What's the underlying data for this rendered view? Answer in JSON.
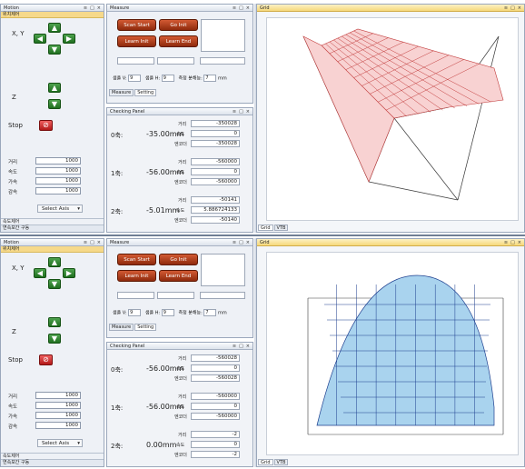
{
  "instances": [
    {
      "motion": {
        "title": "Motion",
        "ctrl_pin": "≅",
        "ctrl_float": "□",
        "ctrl_close": "×",
        "group": "위치제어",
        "xy_label": "X, Y",
        "z_label": "Z",
        "stop_label": "Stop",
        "params": [
          {
            "label": "거리",
            "value": "1000"
          },
          {
            "label": "속도",
            "value": "1000"
          },
          {
            "label": "가속",
            "value": "1000"
          },
          {
            "label": "감속",
            "value": "1000"
          }
        ],
        "select_axis": "Select Axis",
        "footer1": "속도제어",
        "footer2": "연속보간 구동"
      },
      "measure": {
        "title": "Measure",
        "scan_start": "Scan Start",
        "go_init": "Go Init",
        "learn_init": "Learn Init",
        "learn_end": "Learn End",
        "sample_v_label": "샘플 V:",
        "sample_v": "9",
        "sample_h_label": "샘플 H:",
        "sample_h": "9",
        "resolution_label": "측정 분해능:",
        "resolution": "7",
        "unit": "mm",
        "tab_measure": "Measure",
        "tab_setting": "Setting"
      },
      "checking": {
        "title": "Checking Panel",
        "axes": [
          {
            "name": "0축:",
            "pos": "-35.00mm",
            "dist": "-350028",
            "speed": "0",
            "encoder": "-350028"
          },
          {
            "name": "1축:",
            "pos": "-56.00mm",
            "dist": "-560000",
            "speed": "0",
            "encoder": "-560000"
          },
          {
            "name": "2축:",
            "pos": "-5.01mm",
            "dist": "-50141",
            "speed": "5.886724̂133",
            "encoder": "-50140"
          }
        ],
        "lbl_dist": "거리",
        "lbl_speed": "속도",
        "lbl_encoder": "엔코더"
      },
      "grid": {
        "title": "Grid",
        "tab_grid": "Grid",
        "tab_vtb": "VTB"
      }
    },
    {
      "motion": {
        "title": "Motion",
        "ctrl_pin": "≅",
        "ctrl_float": "□",
        "ctrl_close": "×",
        "group": "위치제어",
        "xy_label": "X, Y",
        "z_label": "Z",
        "stop_label": "Stop",
        "params": [
          {
            "label": "거리",
            "value": "1000"
          },
          {
            "label": "속도",
            "value": "1000"
          },
          {
            "label": "가속",
            "value": "1000"
          },
          {
            "label": "감속",
            "value": "1000"
          }
        ],
        "select_axis": "Select Axis",
        "footer1": "속도제어",
        "footer2": "연속보간 구동"
      },
      "measure": {
        "title": "Measure",
        "scan_start": "Scan Start",
        "go_init": "Go Init",
        "learn_init": "Learn Init",
        "learn_end": "Learn End",
        "sample_v_label": "샘플 V:",
        "sample_v": "9",
        "sample_h_label": "샘플 H:",
        "sample_h": "9",
        "resolution_label": "측정 분해능:",
        "resolution": "7",
        "unit": "mm",
        "tab_measure": "Measure",
        "tab_setting": "Setting"
      },
      "checking": {
        "title": "Checking Panel",
        "axes": [
          {
            "name": "0축:",
            "pos": "-56.00mm",
            "dist": "-560028",
            "speed": "0",
            "encoder": "-560028"
          },
          {
            "name": "1축:",
            "pos": "-56.00mm",
            "dist": "-560000",
            "speed": "0",
            "encoder": "-560000"
          },
          {
            "name": "2축:",
            "pos": "0.00mm",
            "dist": "-2",
            "speed": "0",
            "encoder": "-2"
          }
        ],
        "lbl_dist": "거리",
        "lbl_speed": "속도",
        "lbl_encoder": "엔코더"
      },
      "grid": {
        "title": "Grid",
        "tab_grid": "Grid",
        "tab_vtb": "VTB"
      }
    }
  ],
  "colors": {
    "surface_top_fill": "#f8d2d2",
    "surface_top_line": "#c23b3b",
    "surface_bottom_fill": "#a9d3ee",
    "surface_bottom_line": "#1d3f8f",
    "box_line": "#3a3a3a"
  }
}
